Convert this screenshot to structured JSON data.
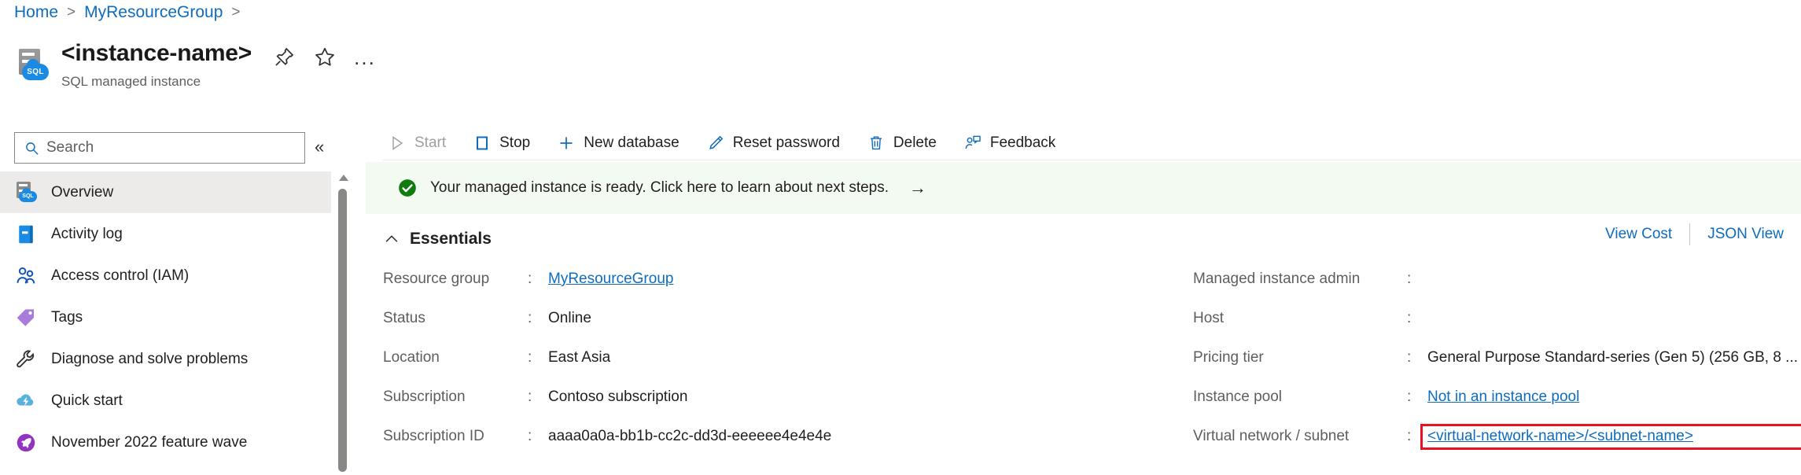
{
  "breadcrumb": {
    "items": [
      {
        "label": "Home",
        "sep": ">"
      },
      {
        "label": "MyResourceGroup",
        "sep": ">"
      }
    ],
    "separator": ">"
  },
  "header": {
    "resource_name": "<instance-name>",
    "resource_type": "SQL managed instance",
    "icon": "sql-managed-instance-icon",
    "icon_text": "SQL",
    "actions": [
      {
        "name": "pin-icon",
        "label": "Pin"
      },
      {
        "name": "favorite-star-icon",
        "label": "Favorite"
      },
      {
        "name": "more-options-icon",
        "label": "..."
      }
    ]
  },
  "sidebar": {
    "search": {
      "placeholder": "Search",
      "value": "",
      "icon": "search-icon"
    },
    "collapse_label": "«",
    "items": [
      {
        "label": "Overview",
        "icon": "sql-managed-instance-icon",
        "selected": true
      },
      {
        "label": "Activity log",
        "icon": "activity-log-icon",
        "selected": false
      },
      {
        "label": "Access control (IAM)",
        "icon": "access-control-icon",
        "selected": false
      },
      {
        "label": "Tags",
        "icon": "tags-icon",
        "selected": false
      },
      {
        "label": "Diagnose and solve problems",
        "icon": "wrench-icon",
        "selected": false
      },
      {
        "label": "Quick start",
        "icon": "quick-start-icon",
        "selected": false
      },
      {
        "label": "November 2022 feature wave",
        "icon": "rocket-icon",
        "selected": false
      }
    ]
  },
  "toolbar": {
    "buttons": [
      {
        "label": "Start",
        "icon": "play-icon",
        "disabled": true
      },
      {
        "label": "Stop",
        "icon": "stop-square-icon",
        "disabled": false
      },
      {
        "label": "New database",
        "icon": "plus-icon",
        "disabled": false
      },
      {
        "label": "Reset password",
        "icon": "pencil-icon",
        "disabled": false
      },
      {
        "label": "Delete",
        "icon": "trash-icon",
        "disabled": false
      },
      {
        "label": "Feedback",
        "icon": "feedback-person-icon",
        "disabled": false
      }
    ]
  },
  "banner": {
    "icon": "success-check-icon",
    "text": "Your managed instance is ready. Click here to learn about next steps.",
    "arrow": "→",
    "background": "#f3faf1",
    "icon_color": "#107c10"
  },
  "essentials": {
    "title": "Essentials",
    "collapse_icon": "chevron-up-icon",
    "view_cost_label": "View Cost",
    "json_view_label": "JSON View",
    "left_properties": [
      {
        "label": "Resource group",
        "colon": ":",
        "value": "MyResourceGroup",
        "is_link": true
      },
      {
        "label": "Status",
        "colon": ":",
        "value": "Online",
        "is_link": false
      },
      {
        "label": "Location",
        "colon": ":",
        "value": "East Asia",
        "is_link": false
      },
      {
        "label": "Subscription",
        "colon": ":",
        "value": "Contoso subscription",
        "is_link": false
      },
      {
        "label": "Subscription ID",
        "colon": ":",
        "value": "aaaa0a0a-bb1b-cc2c-dd3d-eeeeee4e4e4e",
        "is_link": false
      }
    ],
    "right_properties": [
      {
        "label": "Managed instance admin",
        "colon": ":",
        "value": "",
        "is_link": false
      },
      {
        "label": "Host",
        "colon": ":",
        "value": "",
        "is_link": false
      },
      {
        "label": "Pricing tier",
        "colon": ":",
        "value": "General Purpose Standard-series (Gen 5) (256 GB, 8 ...",
        "is_link": false
      },
      {
        "label": "Instance pool",
        "colon": ":",
        "value": "Not in an instance pool",
        "is_link": true
      },
      {
        "label": "Virtual network / subnet",
        "colon": ":",
        "value": "<virtual-network-name>/<subnet-name>",
        "is_link": true,
        "highlighted": true
      }
    ]
  },
  "colors": {
    "link": "#0f6cbd",
    "highlight_outline": "#e81123",
    "selected_nav_bg": "#edebe9",
    "banner_bg": "#f3faf1",
    "success_green": "#107c10",
    "text_secondary": "#605e5c"
  }
}
